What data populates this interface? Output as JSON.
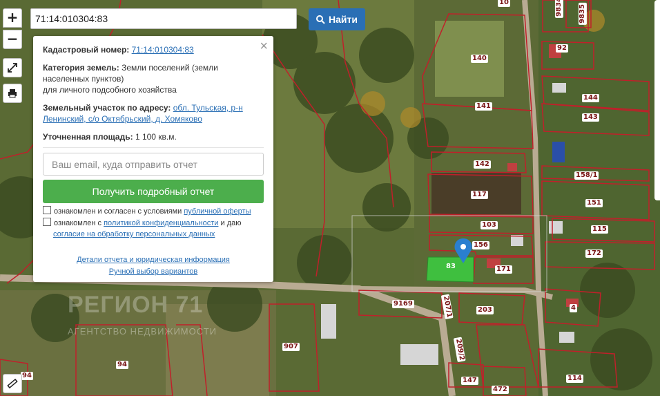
{
  "search": {
    "value": "71:14:010304:83",
    "button_label": "Найти"
  },
  "controls": {
    "zoom_in": "+",
    "zoom_out": "−"
  },
  "popup": {
    "cadastral_label": "Кадастровый номер:",
    "cadastral_value": "71:14:010304:83",
    "category_label": "Категория земель:",
    "category_value": "Земли поселений (земли населенных пунктов)",
    "category_value2": "для личного подсобного хозяйства",
    "address_label": "Земельный участок по адресу:",
    "address_value": "обл. Тульская, р-н Ленинский, с/о Октябрьский, д. Хомяково",
    "area_label": "Уточненная площадь:",
    "area_value": "1 100 кв.м.",
    "email_placeholder": "Ваш email, куда отправить отчет",
    "report_button": "Получить подробный отчет",
    "agree1_text": "ознакомлен и согласен с условиями ",
    "agree1_link": "публичной оферты",
    "agree2_text": "ознакомлен с ",
    "agree2_link": "политикой конфиденциальности",
    "agree2_text2": " и даю",
    "agree2_link2": "согласие на обработку персональных данных",
    "details_link": "Детали отчета и юридическая информация",
    "manual_link": "Ручной выбор вариантов"
  },
  "watermark": {
    "line1": "РЕГИОН 71",
    "line2": "АГЕНТСТВО НЕДВИЖИМОСТИ"
  },
  "parcels": [
    "10",
    "9834",
    "9835",
    "92",
    "140",
    "144",
    "141",
    "143",
    "142",
    "158/1",
    "117",
    "151",
    "103",
    "115",
    "156",
    "172",
    "83",
    "171",
    "9169",
    "203",
    "4",
    "207/1",
    "907",
    "209/2",
    "94",
    "147",
    "472",
    "114",
    "94"
  ],
  "colors": {
    "parcel_border": "#c0202a",
    "selected_fill": "#3fbf3f",
    "marker": "#2a7fd0",
    "button_blue": "#2a6fb5",
    "button_green": "#4cae4c"
  }
}
